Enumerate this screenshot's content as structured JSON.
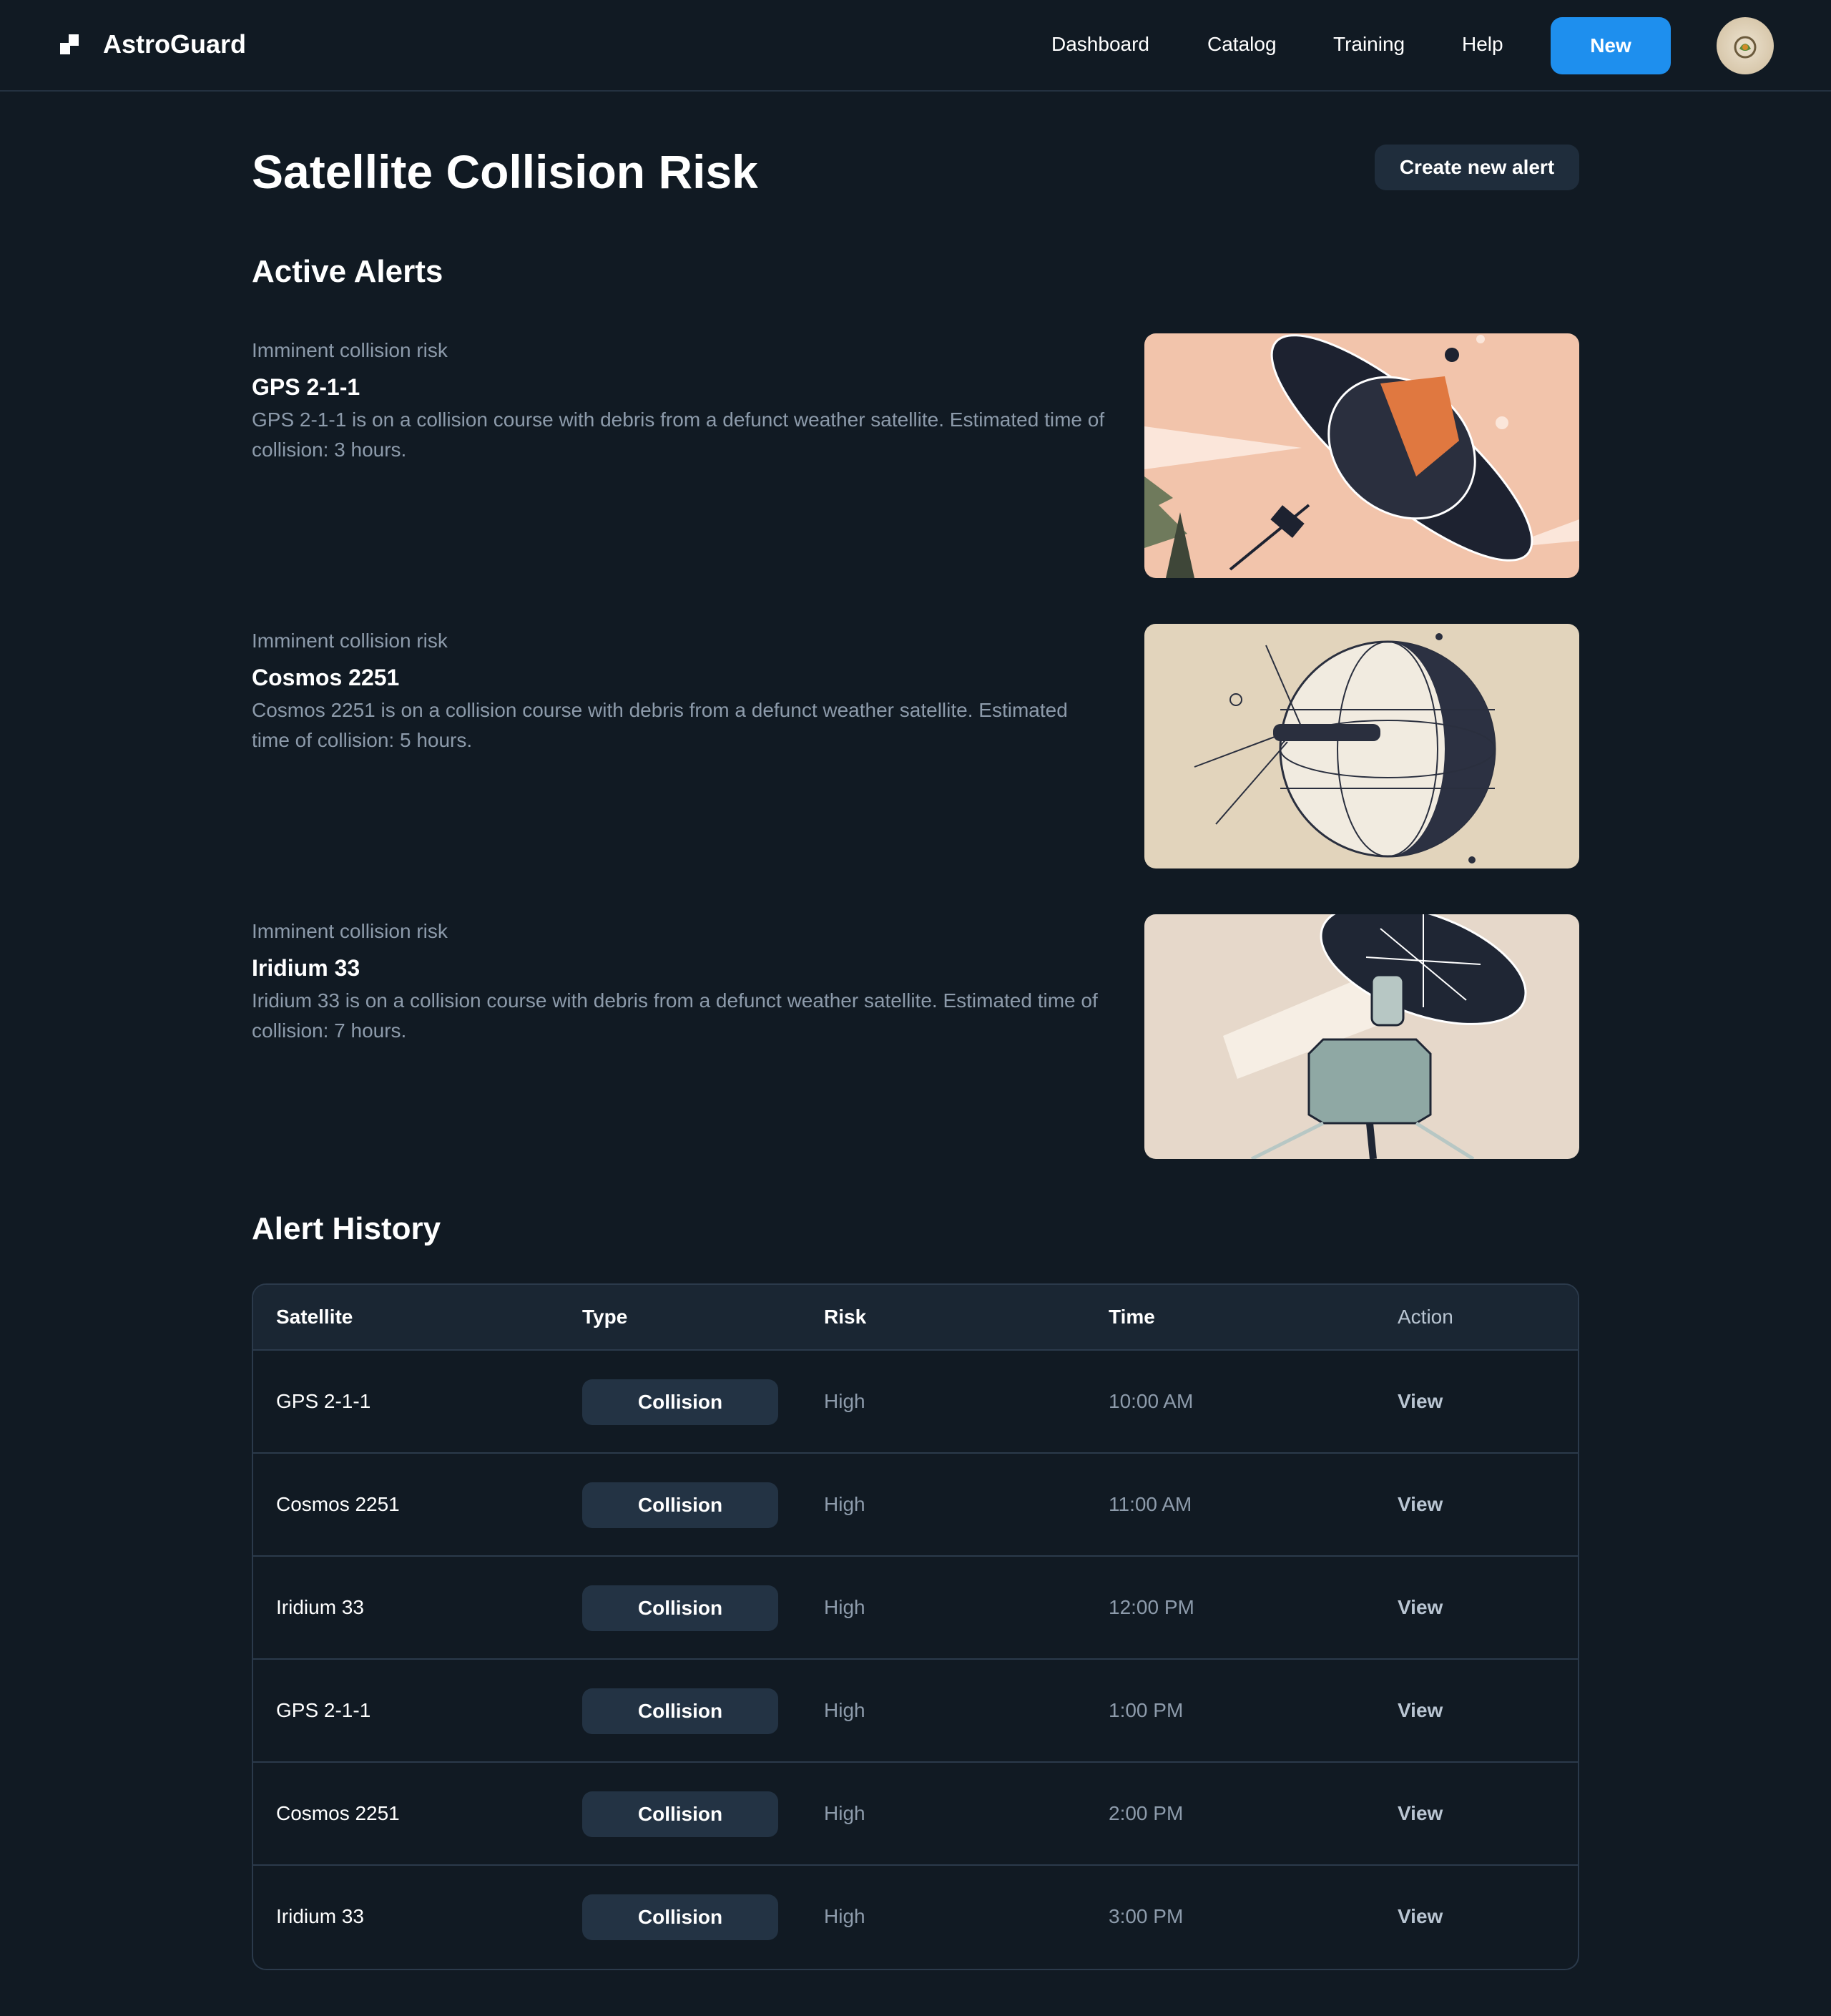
{
  "app": {
    "brand": "AstroGuard"
  },
  "nav": {
    "items": [
      "Dashboard",
      "Catalog",
      "Training",
      "Help"
    ],
    "new_label": "New"
  },
  "colors": {
    "background": "#111a23",
    "accent": "#1e8fee",
    "muted_text": "#8d9bab",
    "pill_bg": "#233344"
  },
  "icons": {
    "logo": "stepped-square-logo-icon",
    "avatar": "avatar-image"
  },
  "page": {
    "title": "Satellite Collision Risk",
    "create_label": "Create new alert"
  },
  "active_alerts": {
    "title": "Active Alerts",
    "items": [
      {
        "kicker": "Imminent collision risk",
        "name": "GPS 2-1-1",
        "description": "GPS 2-1-1 is on a collision course with debris from a defunct weather satellite. Estimated time of collision: 3 hours."
      },
      {
        "kicker": "Imminent collision risk",
        "name": "Cosmos 2251",
        "description": "Cosmos 2251 is on a collision course with debris from a defunct weather satellite. Estimated time of collision: 5 hours."
      },
      {
        "kicker": "Imminent collision risk",
        "name": "Iridium 33",
        "description": "Iridium 33 is on a collision course with debris from a defunct weather satellite. Estimated time of collision: 7 hours."
      }
    ]
  },
  "history": {
    "title": "Alert History",
    "columns": [
      "Satellite",
      "Type",
      "Risk",
      "Time",
      "Action"
    ],
    "rows": [
      {
        "satellite": "GPS 2-1-1",
        "type": "Collision",
        "risk": "High",
        "time": "10:00 AM",
        "action": "View"
      },
      {
        "satellite": "Cosmos 2251",
        "type": "Collision",
        "risk": "High",
        "time": "11:00 AM",
        "action": "View"
      },
      {
        "satellite": "Iridium 33",
        "type": "Collision",
        "risk": "High",
        "time": "12:00 PM",
        "action": "View"
      },
      {
        "satellite": "GPS 2-1-1",
        "type": "Collision",
        "risk": "High",
        "time": "1:00 PM",
        "action": "View"
      },
      {
        "satellite": "Cosmos 2251",
        "type": "Collision",
        "risk": "High",
        "time": "2:00 PM",
        "action": "View"
      },
      {
        "satellite": "Iridium 33",
        "type": "Collision",
        "risk": "High",
        "time": "3:00 PM",
        "action": "View"
      }
    ]
  }
}
